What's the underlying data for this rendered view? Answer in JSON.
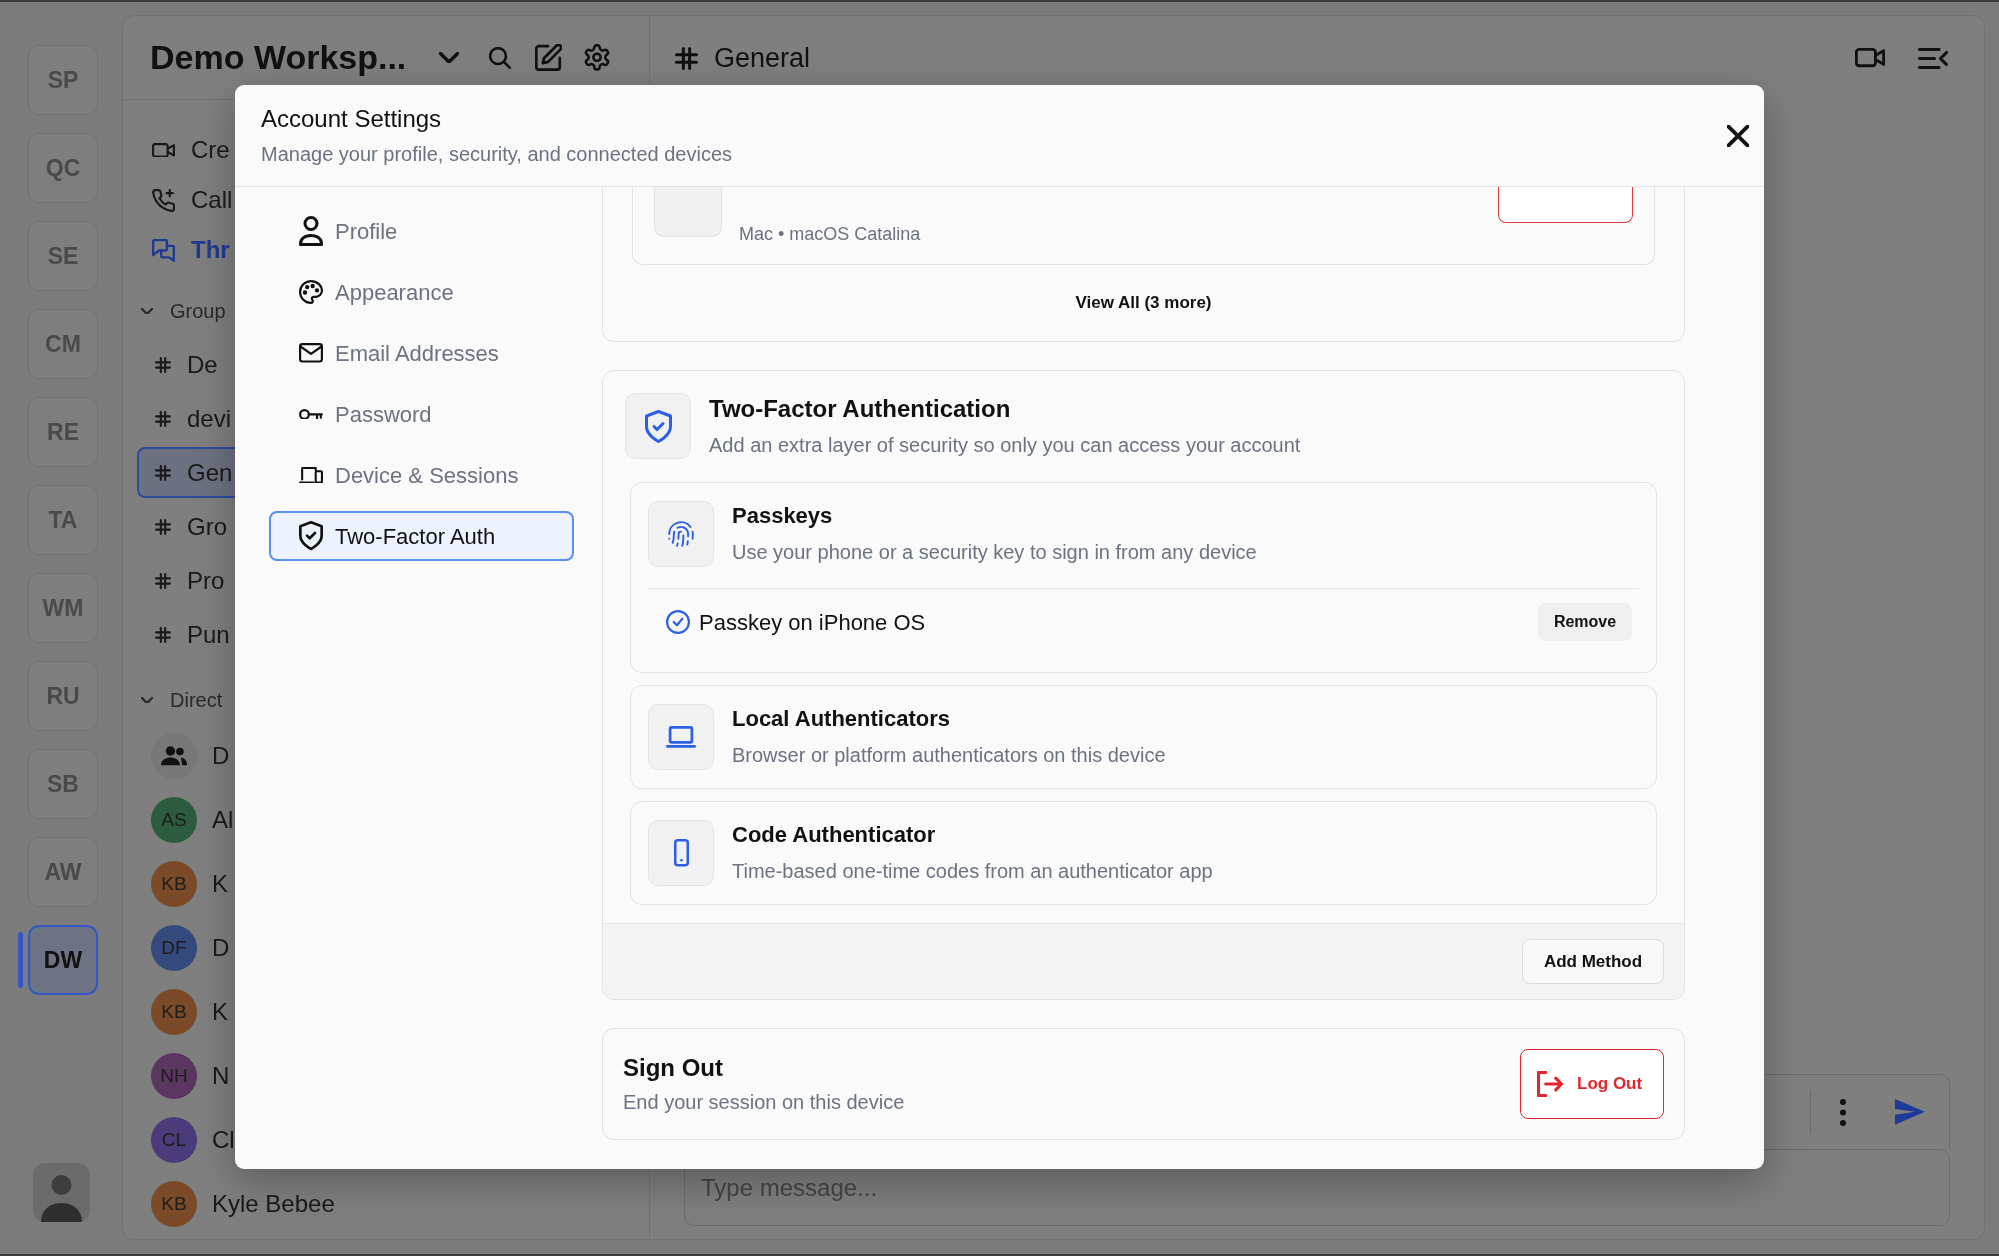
{
  "workspaces": [
    {
      "initials": "SP",
      "selected": false
    },
    {
      "initials": "QC",
      "selected": false
    },
    {
      "initials": "SE",
      "selected": false
    },
    {
      "initials": "CM",
      "selected": false
    },
    {
      "initials": "RE",
      "selected": false
    },
    {
      "initials": "TA",
      "selected": false
    },
    {
      "initials": "WM",
      "selected": false
    },
    {
      "initials": "RU",
      "selected": false
    },
    {
      "initials": "SB",
      "selected": false
    },
    {
      "initials": "AW",
      "selected": false
    },
    {
      "initials": "DW",
      "selected": true
    }
  ],
  "sidebar": {
    "workspace_name": "Demo Worksp...",
    "shortcuts": [
      {
        "label": "Cre",
        "unread": false
      },
      {
        "label": "Call",
        "unread": false
      },
      {
        "label": "Thr",
        "unread": true
      }
    ],
    "groups": {
      "label": "Group",
      "expanded": true,
      "channels": [
        {
          "name": "De",
          "selected": false
        },
        {
          "name": "devi",
          "selected": false
        },
        {
          "name": "Gen",
          "selected": true
        },
        {
          "name": "Gro",
          "selected": false
        },
        {
          "name": "Pro",
          "selected": false
        },
        {
          "name": "Pun",
          "selected": false
        }
      ]
    },
    "direct": {
      "label": "Direct",
      "expanded": true,
      "conversations": [
        {
          "kind": "group",
          "name": "D"
        },
        {
          "kind": "person",
          "initials": "AS",
          "name": "Al",
          "color": "#2d5b3e"
        },
        {
          "kind": "person",
          "initials": "KB",
          "name": "K",
          "color": "#7b4a28"
        },
        {
          "kind": "person",
          "initials": "DF",
          "name": "D",
          "color": "#34497c"
        },
        {
          "kind": "person",
          "initials": "KB",
          "name": "K",
          "color": "#7b4a28"
        },
        {
          "kind": "person",
          "initials": "NH",
          "name": "N",
          "color": "#5b3661"
        },
        {
          "kind": "person",
          "initials": "CL",
          "name": "Cl",
          "color": "#4b3b7a"
        },
        {
          "kind": "person",
          "initials": "KB",
          "name": "Kyle Bebee",
          "color": "#7b4a28"
        }
      ]
    }
  },
  "channel": {
    "name": "General"
  },
  "composer": {
    "placeholder": "Type message..."
  },
  "modal": {
    "title": "Account Settings",
    "subtitle": "Manage your profile, security, and connected devices",
    "nav": [
      {
        "label": "Profile",
        "selected": false
      },
      {
        "label": "Appearance",
        "selected": false
      },
      {
        "label": "Email Addresses",
        "selected": false
      },
      {
        "label": "Password",
        "selected": false
      },
      {
        "label": "Device & Sessions",
        "selected": false
      },
      {
        "label": "Two-Factor Auth",
        "selected": true
      }
    ],
    "sessions": {
      "device_details": "Mac • macOS Catalina",
      "view_all": "View All (3 more)"
    },
    "two_factor": {
      "title": "Two-Factor Authentication",
      "description": "Add an extra layer of security so only you can access your account",
      "methods": [
        {
          "title": "Passkeys",
          "description": "Use your phone or a security key to sign in from any device",
          "entries": [
            {
              "name": "Passkey on iPhone OS",
              "action": "Remove"
            }
          ]
        },
        {
          "title": "Local Authenticators",
          "description": "Browser or platform authenticators on this device"
        },
        {
          "title": "Code Authenticator",
          "description": "Time-based one-time codes from an authenticator app"
        }
      ],
      "add_button": "Add Method"
    },
    "sign_out": {
      "title": "Sign Out",
      "description": "End your session on this device",
      "button": "Log Out"
    }
  }
}
